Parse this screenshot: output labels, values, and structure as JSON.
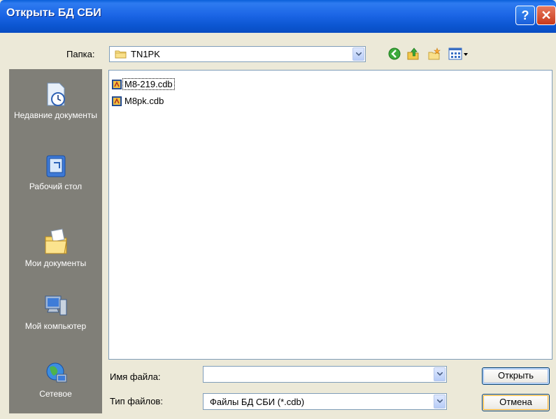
{
  "window": {
    "title": "Открыть БД СБИ",
    "help_button": "?",
    "close_button": "✕"
  },
  "lookin": {
    "label": "Папка:",
    "value": "TN1PK"
  },
  "places": [
    {
      "label": "Недавние документы",
      "icon": "recent-documents-icon"
    },
    {
      "label": "Рабочий стол",
      "icon": "desktop-icon"
    },
    {
      "label": "Мои документы",
      "icon": "my-documents-icon"
    },
    {
      "label": "Мой компьютер",
      "icon": "my-computer-icon"
    },
    {
      "label": "Сетевое",
      "icon": "network-icon"
    }
  ],
  "files": [
    {
      "name": "M8-219.cdb",
      "icon": "cdb-file-icon"
    },
    {
      "name": "M8pk.cdb",
      "icon": "cdb-file-icon"
    }
  ],
  "filename": {
    "label": "Имя файла:",
    "value": ""
  },
  "filetype": {
    "label": "Тип файлов:",
    "value": "Файлы БД СБИ (*.cdb)"
  },
  "buttons": {
    "open": "Открыть",
    "cancel": "Отмена"
  },
  "colors": {
    "titlebar": "#0A5FD9",
    "places_bar": "#807F78",
    "dialog_bg": "#ECE9D8"
  }
}
